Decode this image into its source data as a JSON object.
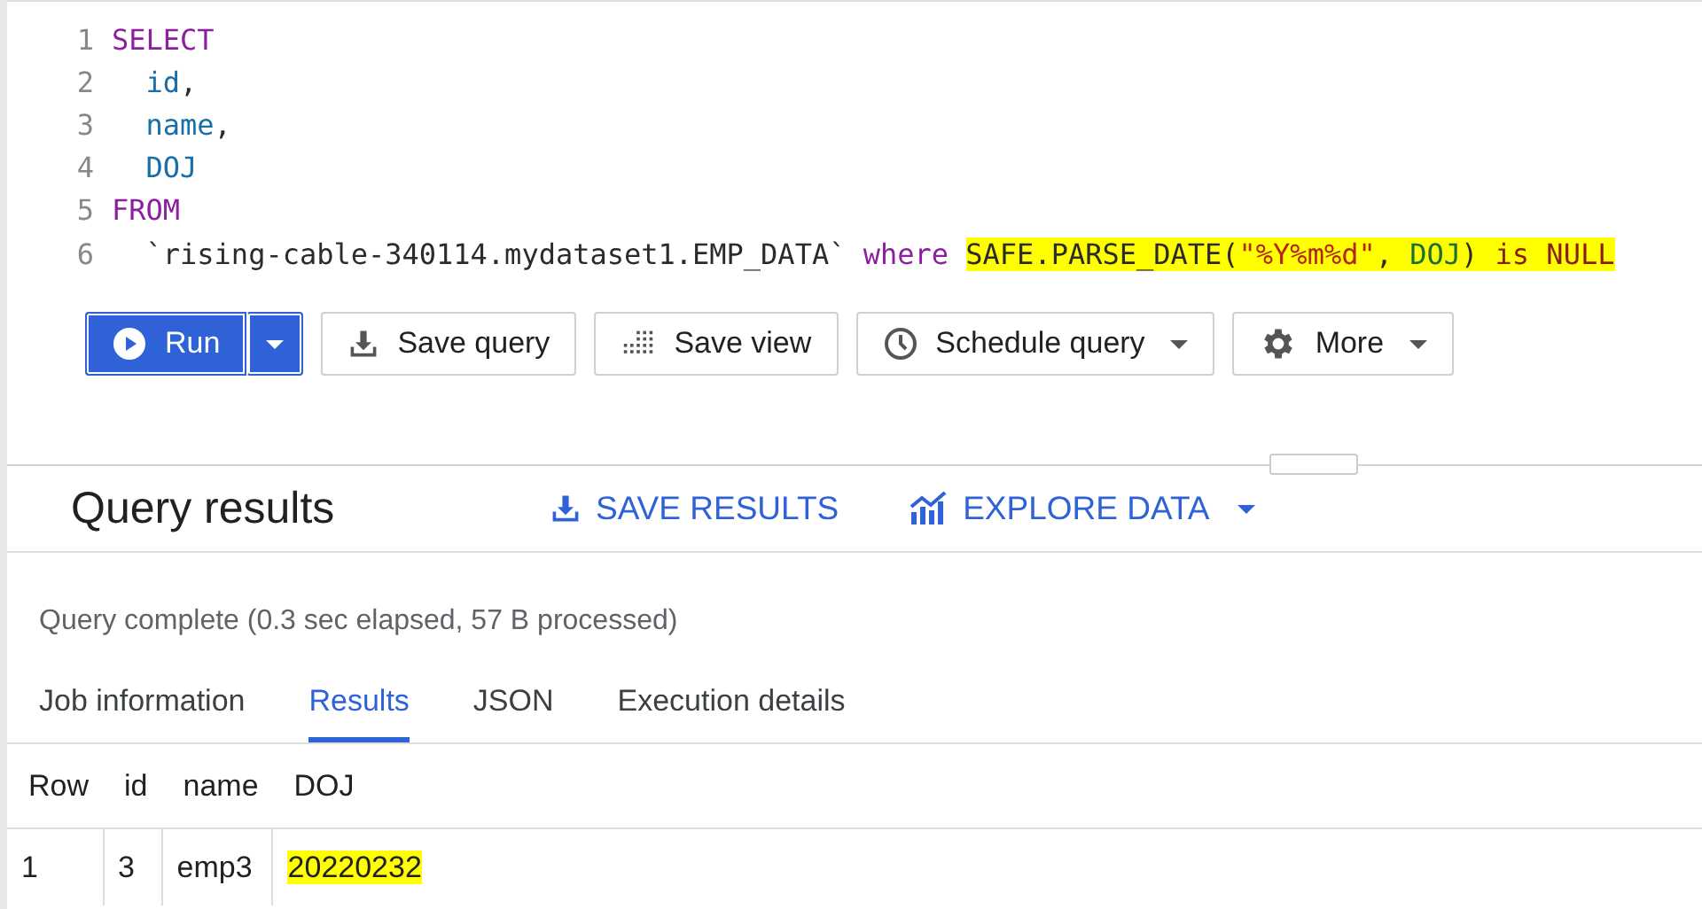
{
  "editor": {
    "lines": [
      {
        "number": "1",
        "tokens": [
          {
            "text": "SELECT",
            "kind": "keyword",
            "highlighted": false
          }
        ]
      },
      {
        "number": "2",
        "tokens": [
          {
            "text": "  id",
            "kind": "ident",
            "highlighted": false
          },
          {
            "text": ",",
            "kind": "plain",
            "highlighted": false
          }
        ]
      },
      {
        "number": "3",
        "tokens": [
          {
            "text": "  name",
            "kind": "ident",
            "highlighted": false
          },
          {
            "text": ",",
            "kind": "plain",
            "highlighted": false
          }
        ]
      },
      {
        "number": "4",
        "tokens": [
          {
            "text": "  DOJ",
            "kind": "ident",
            "highlighted": false
          }
        ]
      },
      {
        "number": "5",
        "tokens": [
          {
            "text": "FROM",
            "kind": "keyword",
            "highlighted": false
          }
        ]
      },
      {
        "number": "6",
        "tokens": [
          {
            "text": "  `rising-cable-340114.mydataset1.EMP_DATA`",
            "kind": "plain",
            "highlighted": false
          },
          {
            "text": " where ",
            "kind": "keyword",
            "highlighted": false
          },
          {
            "text": "SAFE.PARSE_DATE(",
            "kind": "plain",
            "highlighted": true
          },
          {
            "text": "\"%Y%m%d\"",
            "kind": "string",
            "highlighted": true
          },
          {
            "text": ", ",
            "kind": "plain",
            "highlighted": true
          },
          {
            "text": "DOJ",
            "kind": "ident2",
            "highlighted": true
          },
          {
            "text": ") ",
            "kind": "plain",
            "highlighted": true
          },
          {
            "text": "is NULL",
            "kind": "keyword2",
            "highlighted": true
          }
        ]
      }
    ]
  },
  "toolbar": [
    {
      "label": "Run",
      "kind": "primary",
      "menu": true
    },
    {
      "label": "Save query",
      "kind": "download",
      "menu": false
    },
    {
      "label": "Save view",
      "kind": "grid",
      "menu": false
    },
    {
      "label": "Schedule query",
      "kind": "clock",
      "menu": true
    },
    {
      "label": "More",
      "kind": "gear",
      "menu": true
    }
  ],
  "results": {
    "title": "Query results",
    "actions": [
      {
        "label": "SAVE RESULTS",
        "kind": "download",
        "menu": false
      },
      {
        "label": "EXPLORE DATA",
        "kind": "chart",
        "menu": true
      }
    ],
    "status": "Query complete (0.3 sec elapsed, 57 B processed)",
    "tabs": [
      {
        "label": "Job information",
        "selected": false
      },
      {
        "label": "Results",
        "selected": true
      },
      {
        "label": "JSON",
        "selected": false
      },
      {
        "label": "Execution details",
        "selected": false
      }
    ],
    "table": {
      "columns": [
        "Row",
        "id",
        "name",
        "DOJ"
      ],
      "rows": [
        [
          {
            "text": "1",
            "highlighted": false
          },
          {
            "text": "3",
            "highlighted": false
          },
          {
            "text": "emp3",
            "highlighted": false
          },
          {
            "text": "20220232",
            "highlighted": true
          }
        ]
      ]
    }
  }
}
